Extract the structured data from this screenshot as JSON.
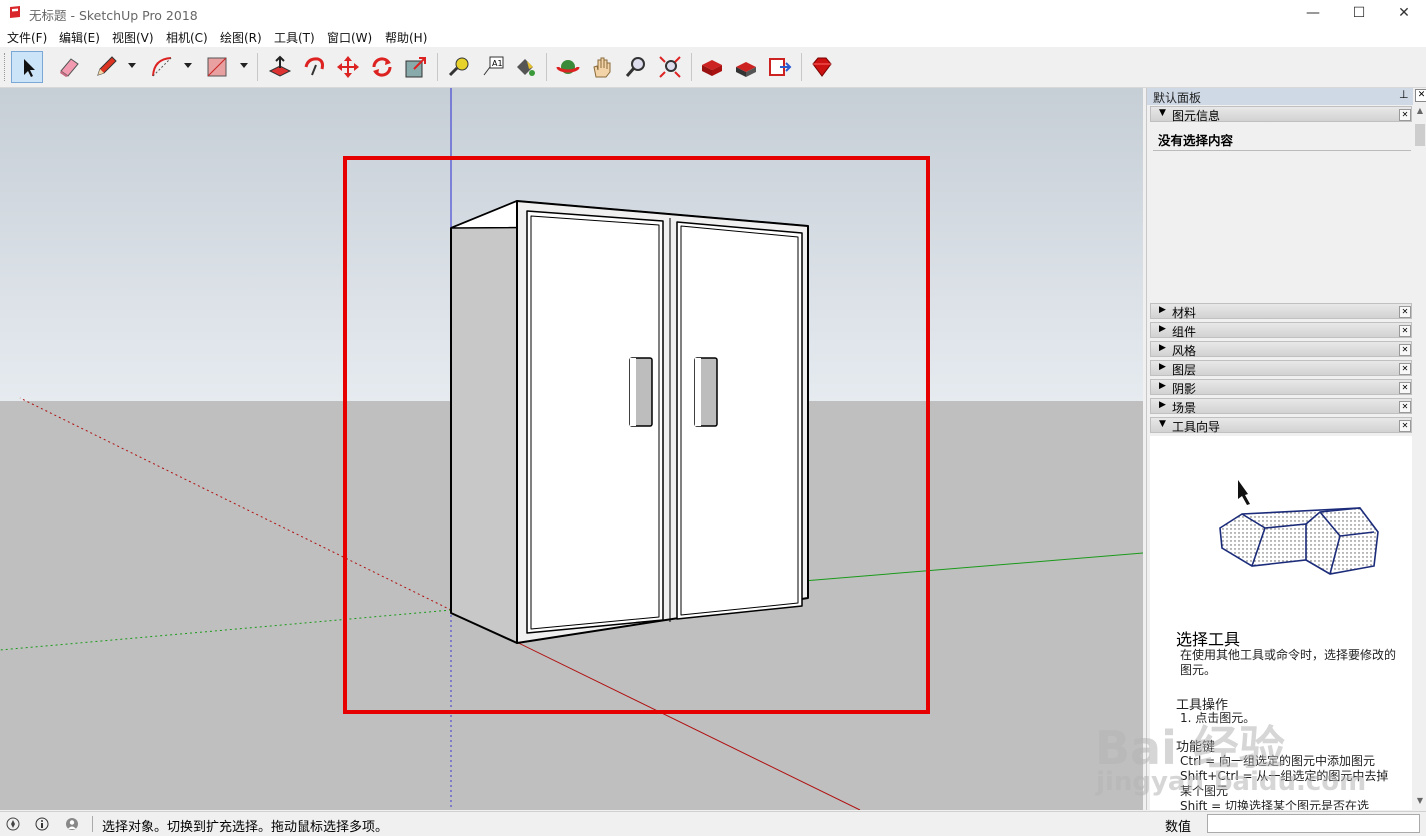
{
  "window": {
    "title": "无标题 - SketchUp Pro 2018",
    "minimize": "—",
    "maximize": "☐",
    "close": "✕"
  },
  "menu": [
    "文件(F)",
    "编辑(E)",
    "视图(V)",
    "相机(C)",
    "绘图(R)",
    "工具(T)",
    "窗口(W)",
    "帮助(H)"
  ],
  "toolbar": {
    "tools": [
      "select-icon",
      "eraser-icon",
      "pencil-icon",
      "arc-icon",
      "rectangle-icon",
      "push-pull-icon",
      "follow-me-icon",
      "move-icon",
      "rotate-icon",
      "scale-icon",
      "tape-measure-icon",
      "text-icon",
      "paint-bucket-icon",
      "orbit-icon",
      "pan-icon",
      "zoom-icon",
      "zoom-extents-icon",
      "warehouse-icon",
      "extension-warehouse-icon",
      "share-model-icon",
      "ruby-icon"
    ]
  },
  "tray": {
    "title": "默认面板",
    "entity_panel": {
      "label": "图元信息",
      "content": "没有选择内容"
    },
    "panels": [
      "材料",
      "组件",
      "风格",
      "图层",
      "阴影",
      "场景",
      "工具向导"
    ],
    "guide": {
      "title": "选择工具",
      "desc": "在使用其他工具或命令时，选择要修改的图元。",
      "ops_heading": "工具操作",
      "ops": "1. 点击图元。",
      "func_heading": "功能键",
      "keys": [
        "Ctrl = 向一组选定的图元中添加图元",
        "Shift+Ctrl = 从一组选定的图元中去掉某个图元",
        "Shift = 切换选择某个图元是否在选"
      ]
    }
  },
  "status": {
    "text": "选择对象。切换到扩充选择。拖动鼠标选择多项。",
    "measure_label": "数值",
    "measure_value": ""
  },
  "watermark": {
    "line1": "Bai 经验",
    "line2": "jingyan.baidu.com"
  },
  "colors": {
    "highlight": "#e60000",
    "sky": "#c8d0d8",
    "ground": "#bebebe"
  }
}
